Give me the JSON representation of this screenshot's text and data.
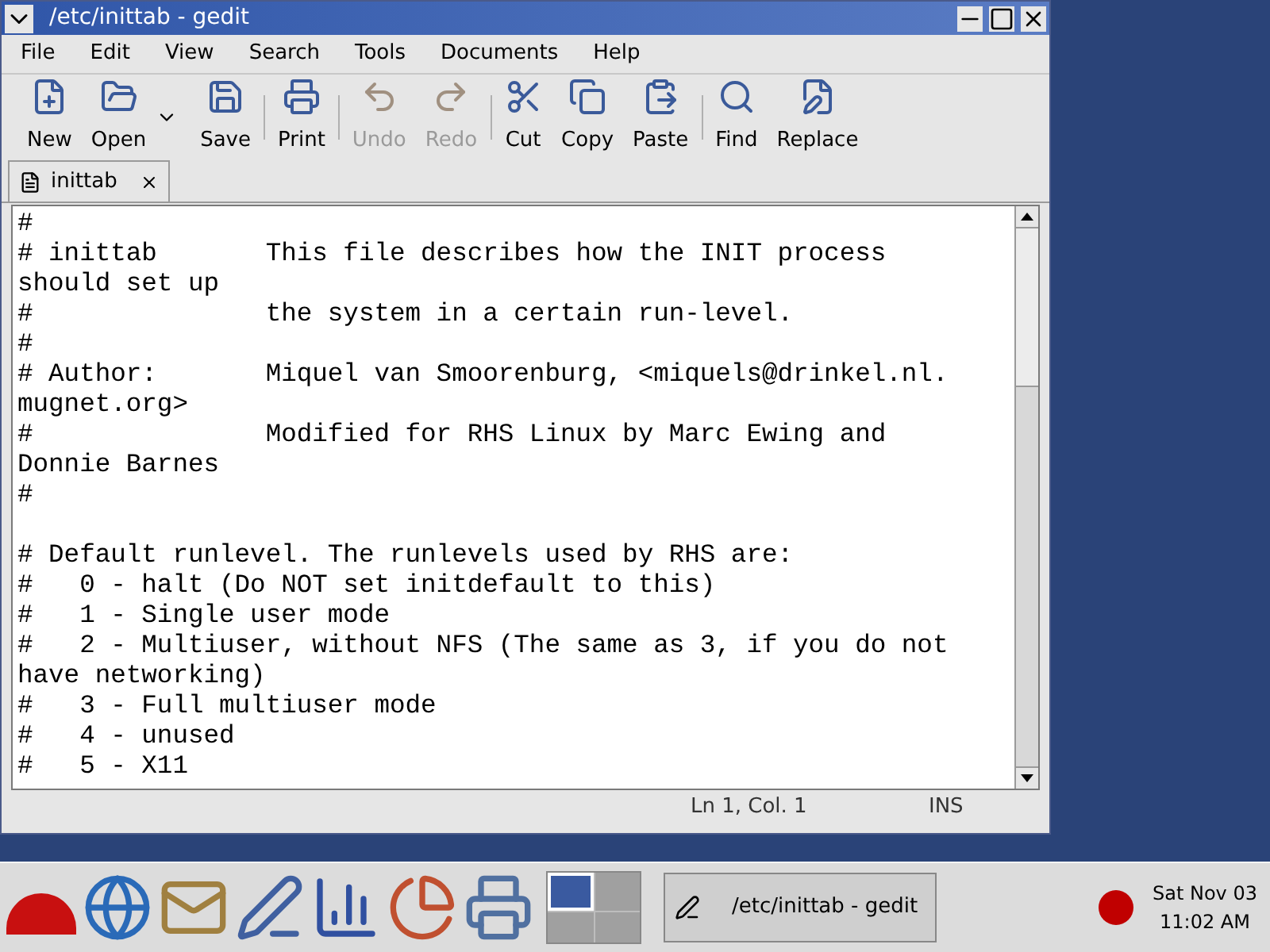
{
  "window": {
    "title": "/etc/inittab - gedit"
  },
  "menu": [
    "File",
    "Edit",
    "View",
    "Search",
    "Tools",
    "Documents",
    "Help"
  ],
  "toolbar": [
    {
      "label": "New",
      "kind": "new",
      "disabled": false
    },
    {
      "label": "Open",
      "kind": "open",
      "disabled": false
    },
    {
      "label": "Save",
      "kind": "save",
      "disabled": false
    },
    {
      "label": "Print",
      "kind": "print",
      "disabled": false
    },
    {
      "label": "Undo",
      "kind": "undo",
      "disabled": true
    },
    {
      "label": "Redo",
      "kind": "redo",
      "disabled": true
    },
    {
      "label": "Cut",
      "kind": "cut",
      "disabled": false
    },
    {
      "label": "Copy",
      "kind": "copy",
      "disabled": false
    },
    {
      "label": "Paste",
      "kind": "paste",
      "disabled": false
    },
    {
      "label": "Find",
      "kind": "find",
      "disabled": false
    },
    {
      "label": "Replace",
      "kind": "replace",
      "disabled": false
    }
  ],
  "tabs": [
    {
      "label": "inittab",
      "selected": true
    }
  ],
  "editor_paragraphs": [
    [
      "#",
      "# inittab       This file describes how the INIT process",
      "should set up",
      "#               the system in a certain run-level.",
      "#",
      "# Author:       Miquel van Smoorenburg, <miquels@drinkel.nl.",
      "mugnet.org>",
      "#               Modified for RHS Linux by Marc Ewing and",
      "Donnie Barnes",
      "#"
    ],
    [
      "# Default runlevel. The runlevels used by RHS are:",
      "#   0 - halt (Do NOT set initdefault to this)",
      "#   1 - Single user mode",
      "#   2 - Multiuser, without NFS (The same as 3, if you do not",
      "have networking)",
      "#   3 - Full multiuser mode",
      "#   4 - unused",
      "#   5 - X11"
    ]
  ],
  "status_bar": {
    "position": "Ln 1, Col. 1",
    "mode": "INS"
  },
  "taskbar": {
    "workspaces": [
      {
        "selected": true
      },
      {
        "selected": false
      },
      {
        "selected": false
      },
      {
        "selected": false
      }
    ],
    "tasks": [
      {
        "label": "/etc/inittab - gedit"
      }
    ],
    "clock": {
      "date": "Sat Nov 03",
      "time": "11:02 AM"
    }
  }
}
